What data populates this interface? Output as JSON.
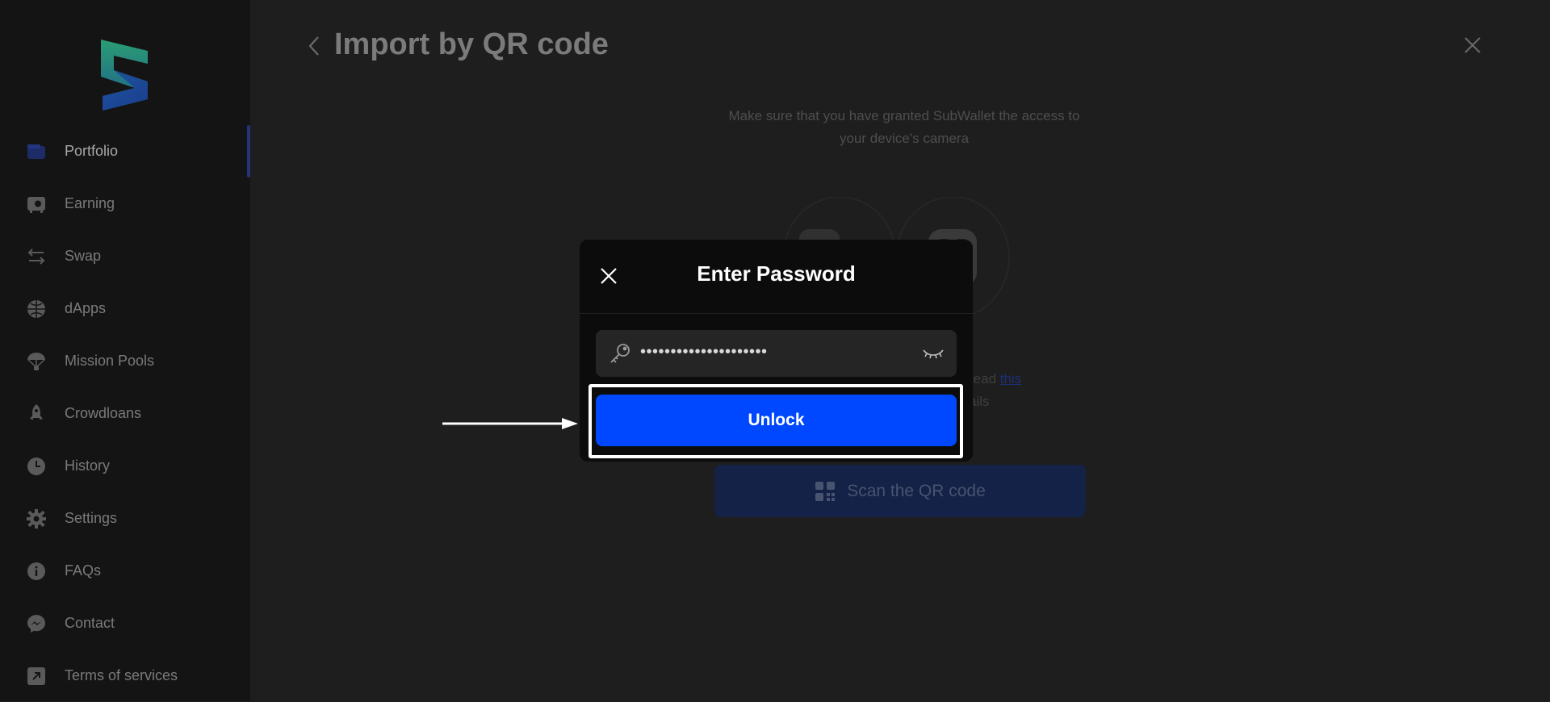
{
  "sidebar": {
    "logo_name": "subwallet-logo",
    "items": [
      {
        "label": "Portfolio",
        "icon": "wallet-icon",
        "active": true
      },
      {
        "label": "Earning",
        "icon": "safe-icon",
        "active": false
      },
      {
        "label": "Swap",
        "icon": "swap-arrows-icon",
        "active": false
      },
      {
        "label": "dApps",
        "icon": "globe-icon",
        "active": false
      },
      {
        "label": "Mission Pools",
        "icon": "parachute-icon",
        "active": false
      },
      {
        "label": "Crowdloans",
        "icon": "rocket-icon",
        "active": false
      },
      {
        "label": "History",
        "icon": "clock-icon",
        "active": false
      },
      {
        "label": "Settings",
        "icon": "gear-icon",
        "active": false
      },
      {
        "label": "FAQs",
        "icon": "info-icon",
        "active": false
      },
      {
        "label": "Contact",
        "icon": "messenger-icon",
        "active": false
      },
      {
        "label": "Terms of services",
        "icon": "external-link-icon",
        "active": false
      }
    ]
  },
  "main": {
    "title": "Import by QR code",
    "description": "Make sure that you have granted SubWallet the access to your device's camera",
    "partial_text_line1": "read ",
    "partial_link": "this",
    "partial_text_line2": "ails",
    "scan_button": "Scan the QR code"
  },
  "modal": {
    "title": "Enter Password",
    "password_value": "•••••••••••••••••••••",
    "unlock_label": "Unlock"
  },
  "colors": {
    "accent": "#0048ff",
    "background": "#1e1e1e",
    "sidebar": "#141414",
    "modal": "#0c0c0c",
    "annotation": "#ffffff"
  }
}
